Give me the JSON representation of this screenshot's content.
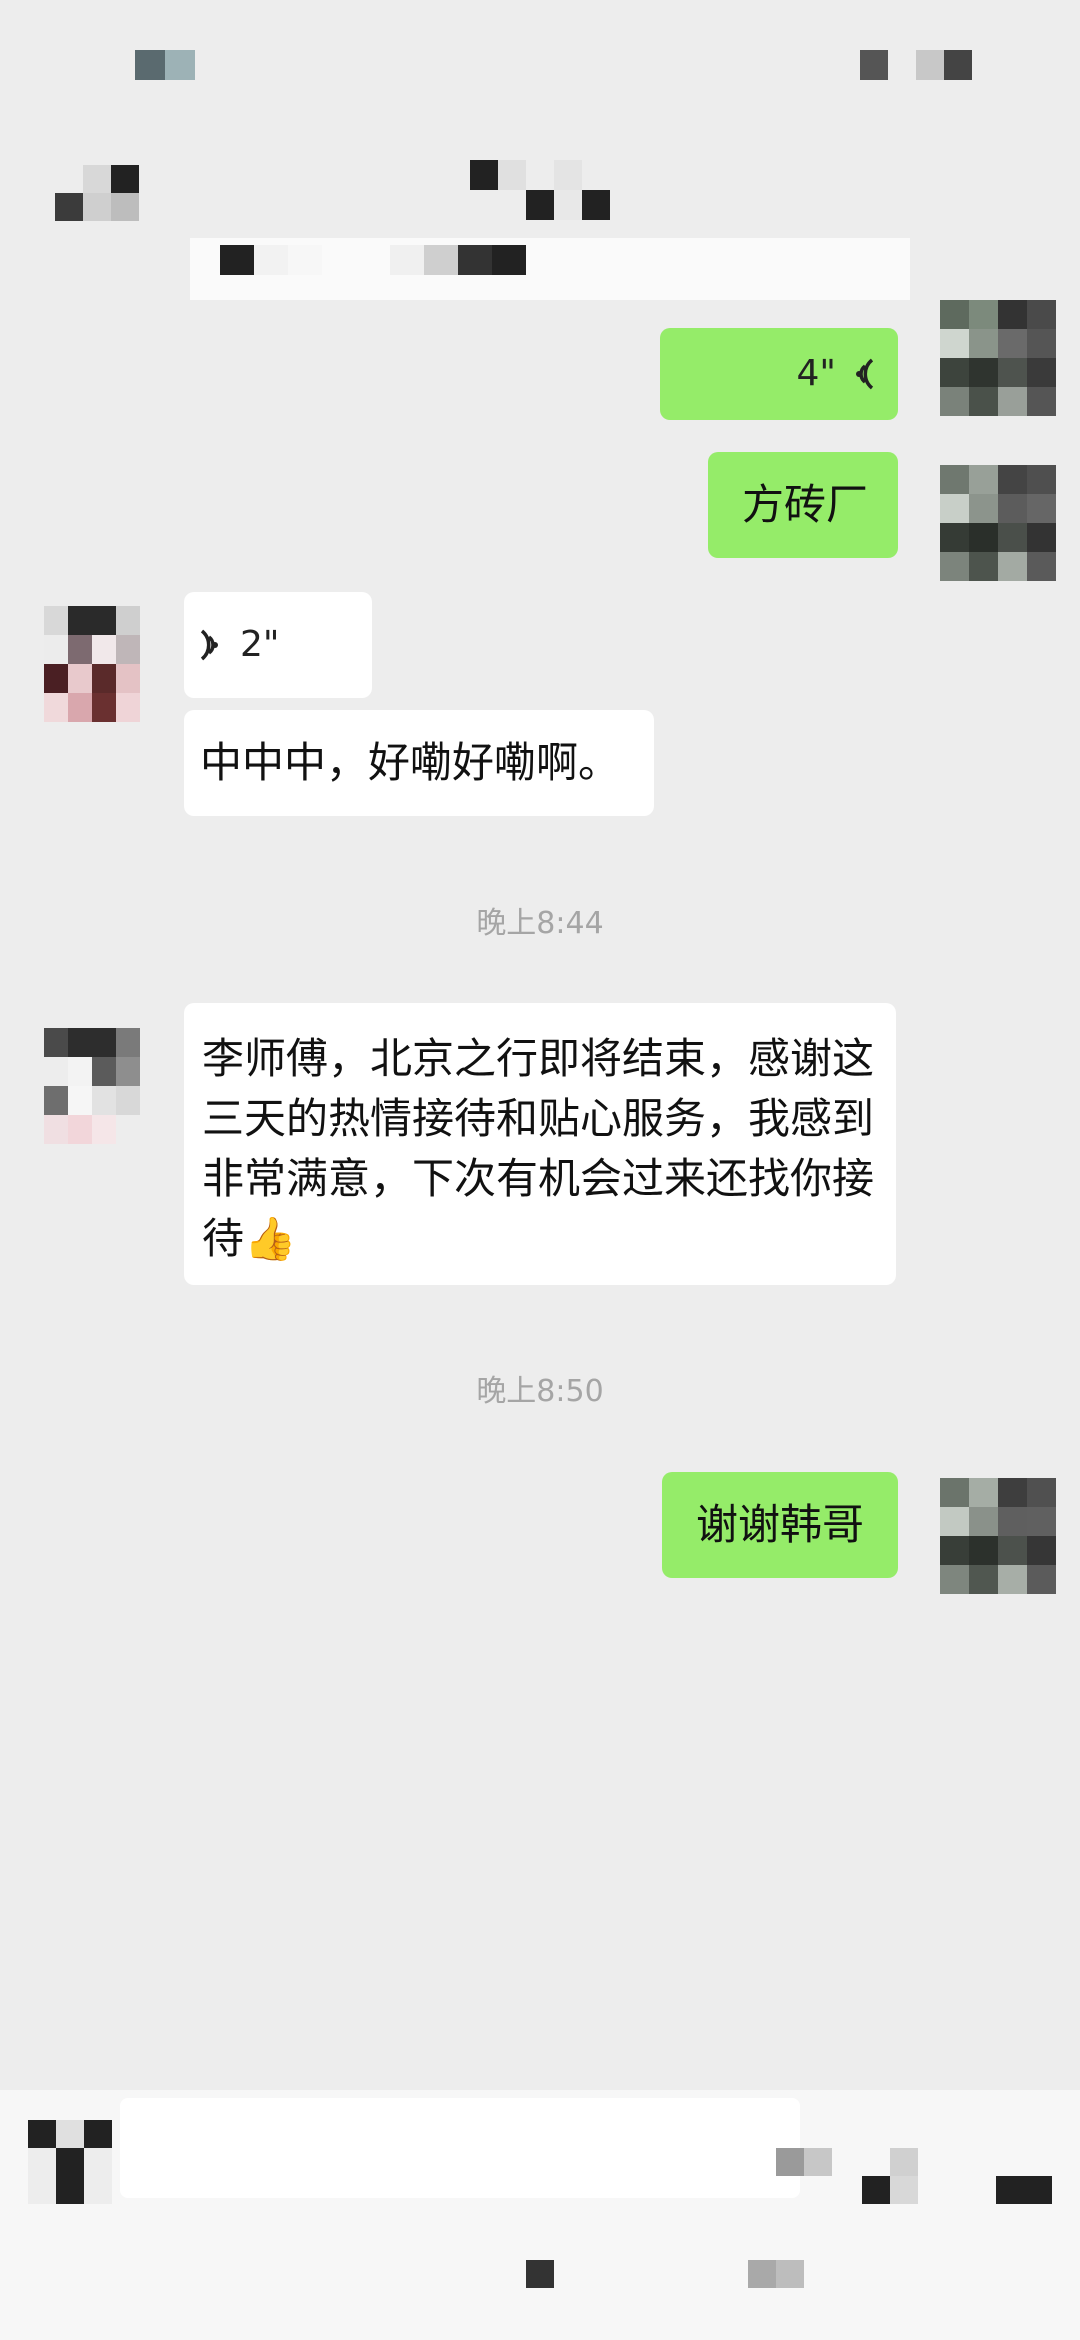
{
  "messages": [
    {
      "side": "out",
      "type": "voice",
      "duration": "4\""
    },
    {
      "side": "out",
      "type": "text",
      "text": "方砖厂"
    },
    {
      "side": "in",
      "type": "voice",
      "duration": "2\""
    },
    {
      "side": "in",
      "type": "text",
      "text": "中中中，好嘞好嘞啊。"
    }
  ],
  "timestamps": [
    "晚上8:44",
    "晚上8:50"
  ],
  "message_long": {
    "text": "李师傅，北京之行即将结束，感谢这三天的热情接待和贴心服务，我感到非常满意，下次有机会过来还找你接待",
    "emoji": "👍"
  },
  "message_reply": {
    "text": "谢谢韩哥"
  },
  "colors": {
    "outgoing_bubble": "#95ec69",
    "incoming_bubble": "#ffffff",
    "background": "#ededed",
    "timestamp": "#a5a5a5"
  },
  "icons": {
    "voice": "voice-wave-icon",
    "thumbs_up": "thumbs-up-emoji"
  }
}
